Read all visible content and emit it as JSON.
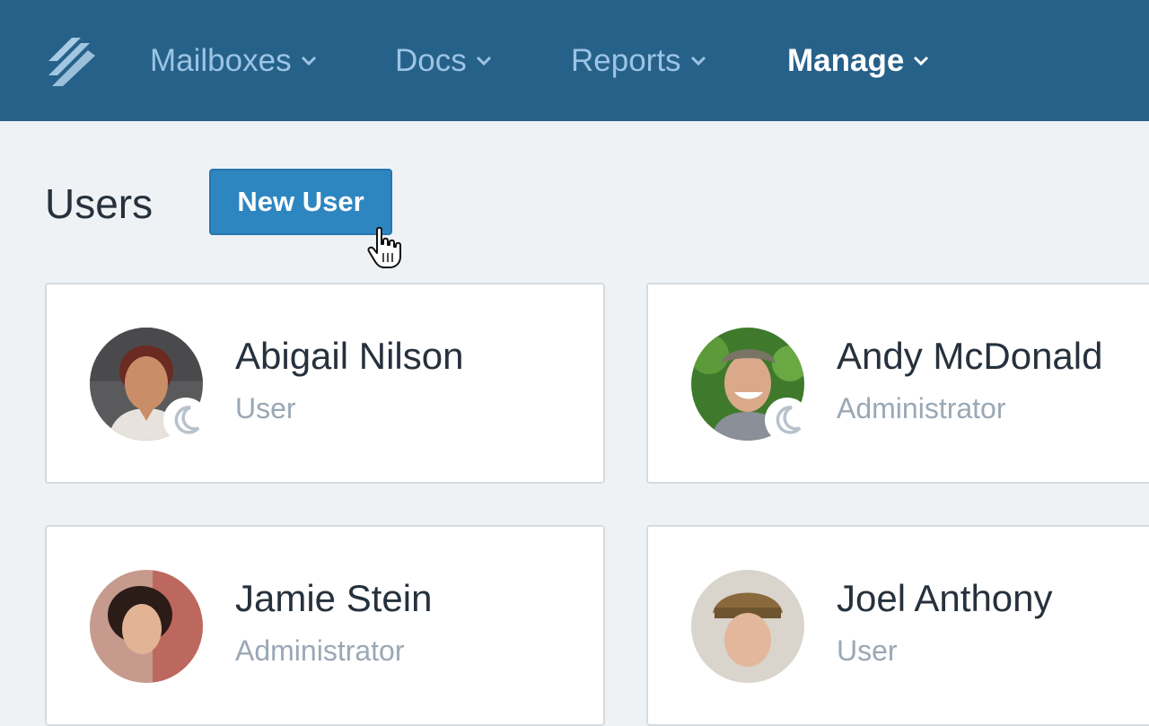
{
  "nav": {
    "items": [
      {
        "label": "Mailboxes"
      },
      {
        "label": "Docs"
      },
      {
        "label": "Reports"
      },
      {
        "label": "Manage"
      }
    ]
  },
  "page": {
    "title": "Users",
    "new_user_label": "New User"
  },
  "users": [
    {
      "name": "Abigail Nilson",
      "role": "User"
    },
    {
      "name": "Andy McDonald",
      "role": "Administrator"
    },
    {
      "name": "Jamie Stein",
      "role": "Administrator"
    },
    {
      "name": "Joel Anthony",
      "role": "User"
    }
  ],
  "colors": {
    "nav_bg": "#266189",
    "accent": "#2e86c1",
    "page_bg": "#eff2f5"
  },
  "icons": [
    "logo-icon",
    "chevron-down-icon",
    "moon-icon",
    "hand-cursor-icon"
  ]
}
